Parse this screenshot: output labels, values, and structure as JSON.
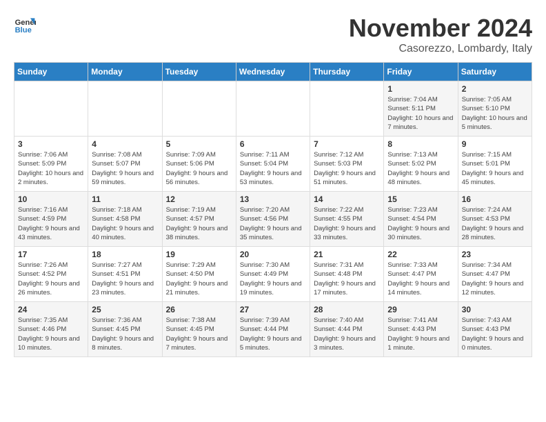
{
  "logo": {
    "line1": "General",
    "line2": "Blue"
  },
  "title": "November 2024",
  "subtitle": "Casorezzo, Lombardy, Italy",
  "headers": [
    "Sunday",
    "Monday",
    "Tuesday",
    "Wednesday",
    "Thursday",
    "Friday",
    "Saturday"
  ],
  "weeks": [
    [
      {
        "day": "",
        "info": ""
      },
      {
        "day": "",
        "info": ""
      },
      {
        "day": "",
        "info": ""
      },
      {
        "day": "",
        "info": ""
      },
      {
        "day": "",
        "info": ""
      },
      {
        "day": "1",
        "info": "Sunrise: 7:04 AM\nSunset: 5:11 PM\nDaylight: 10 hours and 7 minutes."
      },
      {
        "day": "2",
        "info": "Sunrise: 7:05 AM\nSunset: 5:10 PM\nDaylight: 10 hours and 5 minutes."
      }
    ],
    [
      {
        "day": "3",
        "info": "Sunrise: 7:06 AM\nSunset: 5:09 PM\nDaylight: 10 hours and 2 minutes."
      },
      {
        "day": "4",
        "info": "Sunrise: 7:08 AM\nSunset: 5:07 PM\nDaylight: 9 hours and 59 minutes."
      },
      {
        "day": "5",
        "info": "Sunrise: 7:09 AM\nSunset: 5:06 PM\nDaylight: 9 hours and 56 minutes."
      },
      {
        "day": "6",
        "info": "Sunrise: 7:11 AM\nSunset: 5:04 PM\nDaylight: 9 hours and 53 minutes."
      },
      {
        "day": "7",
        "info": "Sunrise: 7:12 AM\nSunset: 5:03 PM\nDaylight: 9 hours and 51 minutes."
      },
      {
        "day": "8",
        "info": "Sunrise: 7:13 AM\nSunset: 5:02 PM\nDaylight: 9 hours and 48 minutes."
      },
      {
        "day": "9",
        "info": "Sunrise: 7:15 AM\nSunset: 5:01 PM\nDaylight: 9 hours and 45 minutes."
      }
    ],
    [
      {
        "day": "10",
        "info": "Sunrise: 7:16 AM\nSunset: 4:59 PM\nDaylight: 9 hours and 43 minutes."
      },
      {
        "day": "11",
        "info": "Sunrise: 7:18 AM\nSunset: 4:58 PM\nDaylight: 9 hours and 40 minutes."
      },
      {
        "day": "12",
        "info": "Sunrise: 7:19 AM\nSunset: 4:57 PM\nDaylight: 9 hours and 38 minutes."
      },
      {
        "day": "13",
        "info": "Sunrise: 7:20 AM\nSunset: 4:56 PM\nDaylight: 9 hours and 35 minutes."
      },
      {
        "day": "14",
        "info": "Sunrise: 7:22 AM\nSunset: 4:55 PM\nDaylight: 9 hours and 33 minutes."
      },
      {
        "day": "15",
        "info": "Sunrise: 7:23 AM\nSunset: 4:54 PM\nDaylight: 9 hours and 30 minutes."
      },
      {
        "day": "16",
        "info": "Sunrise: 7:24 AM\nSunset: 4:53 PM\nDaylight: 9 hours and 28 minutes."
      }
    ],
    [
      {
        "day": "17",
        "info": "Sunrise: 7:26 AM\nSunset: 4:52 PM\nDaylight: 9 hours and 26 minutes."
      },
      {
        "day": "18",
        "info": "Sunrise: 7:27 AM\nSunset: 4:51 PM\nDaylight: 9 hours and 23 minutes."
      },
      {
        "day": "19",
        "info": "Sunrise: 7:29 AM\nSunset: 4:50 PM\nDaylight: 9 hours and 21 minutes."
      },
      {
        "day": "20",
        "info": "Sunrise: 7:30 AM\nSunset: 4:49 PM\nDaylight: 9 hours and 19 minutes."
      },
      {
        "day": "21",
        "info": "Sunrise: 7:31 AM\nSunset: 4:48 PM\nDaylight: 9 hours and 17 minutes."
      },
      {
        "day": "22",
        "info": "Sunrise: 7:33 AM\nSunset: 4:47 PM\nDaylight: 9 hours and 14 minutes."
      },
      {
        "day": "23",
        "info": "Sunrise: 7:34 AM\nSunset: 4:47 PM\nDaylight: 9 hours and 12 minutes."
      }
    ],
    [
      {
        "day": "24",
        "info": "Sunrise: 7:35 AM\nSunset: 4:46 PM\nDaylight: 9 hours and 10 minutes."
      },
      {
        "day": "25",
        "info": "Sunrise: 7:36 AM\nSunset: 4:45 PM\nDaylight: 9 hours and 8 minutes."
      },
      {
        "day": "26",
        "info": "Sunrise: 7:38 AM\nSunset: 4:45 PM\nDaylight: 9 hours and 7 minutes."
      },
      {
        "day": "27",
        "info": "Sunrise: 7:39 AM\nSunset: 4:44 PM\nDaylight: 9 hours and 5 minutes."
      },
      {
        "day": "28",
        "info": "Sunrise: 7:40 AM\nSunset: 4:44 PM\nDaylight: 9 hours and 3 minutes."
      },
      {
        "day": "29",
        "info": "Sunrise: 7:41 AM\nSunset: 4:43 PM\nDaylight: 9 hours and 1 minute."
      },
      {
        "day": "30",
        "info": "Sunrise: 7:43 AM\nSunset: 4:43 PM\nDaylight: 9 hours and 0 minutes."
      }
    ]
  ]
}
